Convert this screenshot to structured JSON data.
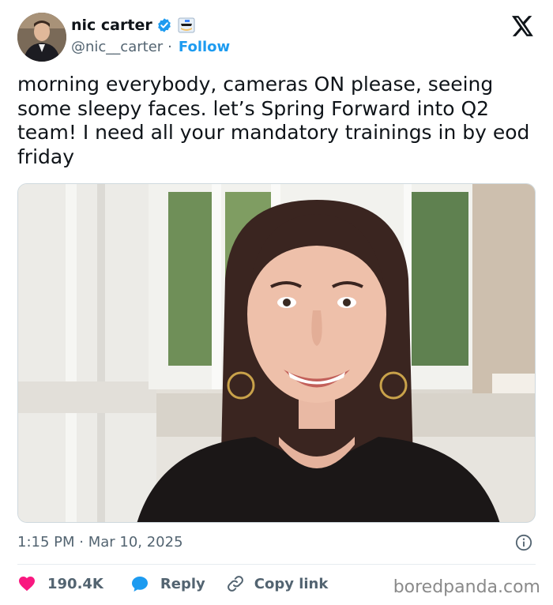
{
  "author": {
    "name": "nic carter",
    "handle": "@nic__carter",
    "separator": "·",
    "follow_label": "Follow"
  },
  "tweet": {
    "text": "morning everybody, cameras ON please, seeing some sleepy faces. let’s Spring Forward into Q2 team! I need all your mandatory trainings in by eod friday",
    "timestamp": "1:15 PM · Mar 10, 2025"
  },
  "actions": {
    "likes": "190.4K",
    "reply_label": "Reply",
    "copy_label": "Copy link"
  },
  "watermark": "boredpanda.com",
  "colors": {
    "accent": "#1d9bf0",
    "like": "#f91880",
    "secondary_text": "#536471"
  },
  "icons": [
    "verified-badge-icon",
    "x-logo-icon",
    "info-icon",
    "heart-icon",
    "reply-bubble-icon",
    "link-icon"
  ]
}
